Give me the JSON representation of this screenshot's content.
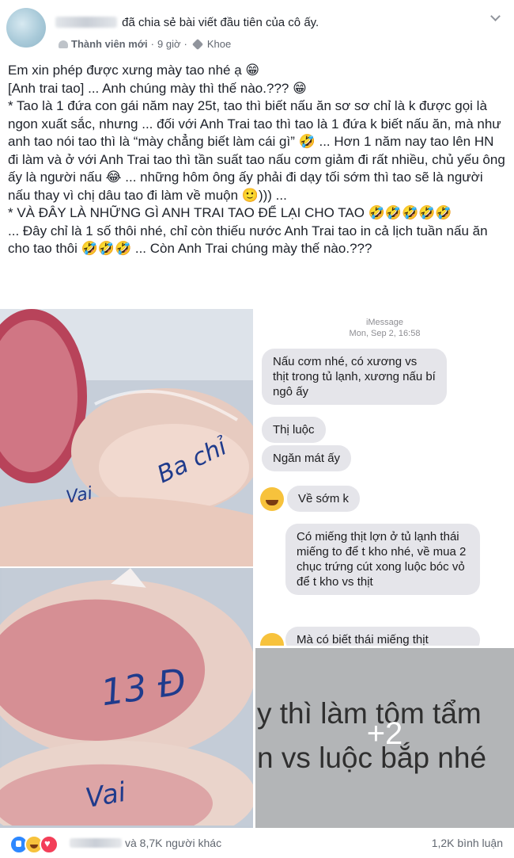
{
  "post": {
    "author_action": "đã chia sẻ bài viết đầu tiên của cô ấy.",
    "role": "Thành viên mới",
    "separator": "·",
    "time": "9 giờ",
    "tag": "Khoe",
    "paragraphs": [
      "Em xin phép được xưng mày tao nhé ạ 😁",
      "[Anh trai tao] ... Anh chúng mày thì thế nào.??? 😁",
      "* Tao là 1 đứa con gái năm nay 25t, tao thì biết nấu ăn sơ sơ chỉ là k được gọi là ngon xuất sắc, nhưng ... đối với Anh Trai tao thì tao là 1 đứa k biết nấu ăn, mà như anh tao nói tao thì là “mày chẳng biết làm cái gì” 🤣 ... Hơn 1 năm nay tao lên HN đi làm và ở với Anh Trai tao thì tần suất tao nấu cơm giảm đi rất nhiều, chủ yếu ông ấy là người nấu 😂 ... những hôm ông ấy phải đi dạy tối sớm thì tao sẽ là người nấu thay vì chị dâu tao đi làm về muộn 🙂))) ...",
      "* VÀ ĐÂY LÀ NHỮNG GÌ ANH TRAI TAO ĐỂ LẠI CHO TAO 🤣🤣🤣🤣🤣",
      "... Đây chỉ là 1 số thôi nhé, chỉ còn thiếu nước Anh Trai tao in cả lịch tuần nấu ăn cho tao thôi 🤣🤣🤣 ... Còn Anh Trai chúng mày thế nào.???"
    ]
  },
  "photos": {
    "photo1": {
      "bag_label": "Ba chỉ",
      "bag_label_2": "Vai"
    },
    "photo2": {
      "bag_label": "13 Đ",
      "bag_label_2": "Vai"
    },
    "photo3": {
      "header_line1": "iMessage",
      "header_line2": "Mon, Sep 2, 16:58",
      "bubbles": [
        "Nấu cơm nhé, có xương vs thịt trong tủ lạnh, xương nấu bí ngô ấy",
        "Thị luộc",
        "Ngăn mát ấy"
      ]
    },
    "photo4": {
      "bubbles": [
        "Về sớm k",
        "Có miếng thịt lợn ở tủ lạnh thái miếng to để t kho nhé, về mua 2 chục trứng cút xong luộc bóc vỏ để t kho vs thịt",
        "Mà có biết thái miếng thịt"
      ]
    },
    "photo5": {
      "text_line1": "y thì làm tôm tẩm",
      "text_line2": "n vs luộc bắp nhé",
      "more_count": "+2"
    }
  },
  "footer": {
    "reactions": [
      "like-icon",
      "haha-icon",
      "love-icon"
    ],
    "reactions_text": "và 8,7K người khác",
    "comments": "1,2K bình luận"
  },
  "colors": {
    "text": "#1d2129",
    "meta": "#616770",
    "bubble": "#e5e5ea",
    "like": "#2d88ff",
    "love": "#f33e58",
    "haha": "#f7c23c"
  }
}
